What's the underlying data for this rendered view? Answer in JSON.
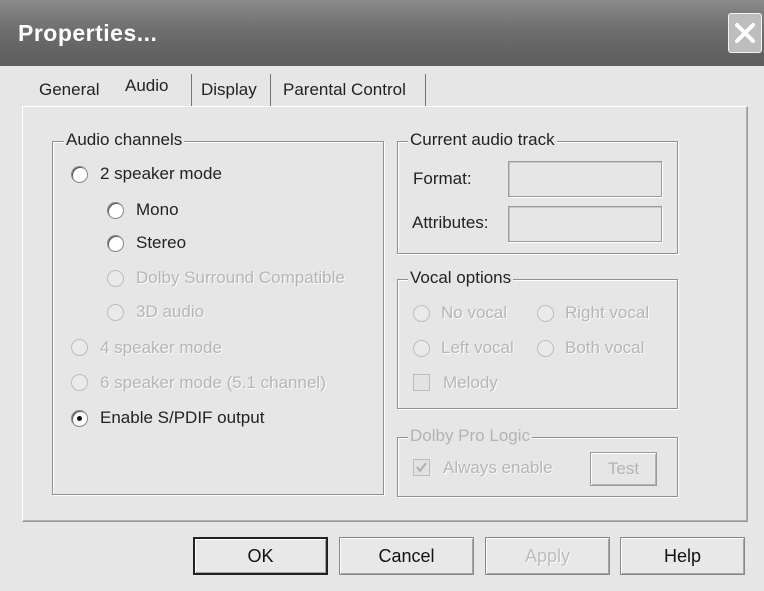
{
  "window": {
    "title": "Properties...",
    "close_icon": "close-icon"
  },
  "tabs": [
    {
      "label": "General",
      "selected": false
    },
    {
      "label": "Audio",
      "selected": true
    },
    {
      "label": "Display",
      "selected": false
    },
    {
      "label": "Parental Control",
      "selected": false
    }
  ],
  "audio_channels": {
    "title": "Audio channels",
    "options": [
      {
        "label": "2 speaker mode",
        "checked": false,
        "enabled": true
      },
      {
        "label": "Mono",
        "checked": false,
        "enabled": true
      },
      {
        "label": "Stereo",
        "checked": false,
        "enabled": true
      },
      {
        "label": "Dolby Surround Compatible",
        "checked": false,
        "enabled": false
      },
      {
        "label": "3D audio",
        "checked": false,
        "enabled": false
      },
      {
        "label": "4 speaker mode",
        "checked": false,
        "enabled": false
      },
      {
        "label": "6 speaker mode (5.1 channel)",
        "checked": false,
        "enabled": false
      },
      {
        "label": "Enable S/PDIF output",
        "checked": true,
        "enabled": true
      }
    ]
  },
  "current_track": {
    "title": "Current audio track",
    "format_label": "Format:",
    "format_value": "",
    "attributes_label": "Attributes:",
    "attributes_value": ""
  },
  "vocal_options": {
    "title": "Vocal options",
    "options": [
      {
        "label": "No vocal",
        "enabled": false
      },
      {
        "label": "Right vocal",
        "enabled": false
      },
      {
        "label": "Left vocal",
        "enabled": false
      },
      {
        "label": "Both vocal",
        "enabled": false
      }
    ],
    "melody_label": "Melody",
    "melody_checked": false
  },
  "dolby": {
    "title": "Dolby Pro Logic",
    "always_enable_label": "Always enable",
    "always_enable_checked": true,
    "test_label": "Test"
  },
  "buttons": {
    "ok": "OK",
    "cancel": "Cancel",
    "apply": "Apply",
    "help": "Help"
  }
}
